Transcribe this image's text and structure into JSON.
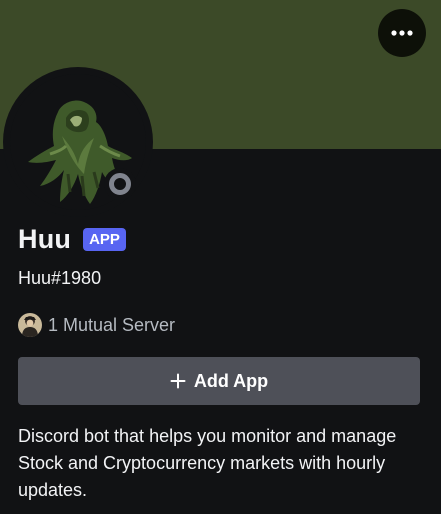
{
  "colors": {
    "banner": "#3c4a28",
    "background": "#111214",
    "brand": "#5865f2",
    "button": "#4e5058",
    "status_offline": "#80848e",
    "text_primary": "#f2f3f5",
    "text_muted": "#b5bac1"
  },
  "header": {
    "more_icon": "more-horizontal-icon"
  },
  "profile": {
    "display_name": "Huu",
    "badge": "APP",
    "username": "Huu#1980",
    "status": "offline",
    "mutual_servers": "1 Mutual Server",
    "add_button": "Add App",
    "bio": "Discord bot that helps you monitor and manage Stock and Cryptocurrency markets with hourly updates."
  }
}
